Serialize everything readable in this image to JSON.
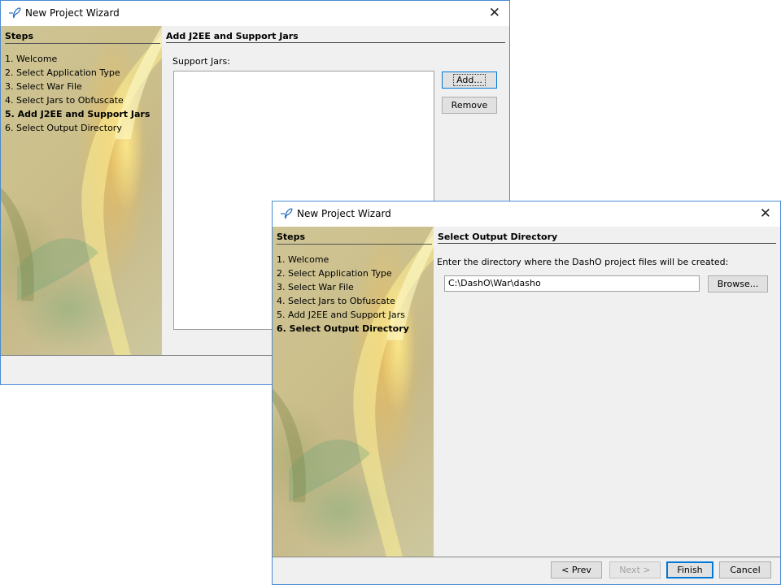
{
  "windows": [
    {
      "title": "New Project Wizard",
      "steps_heading": "Steps",
      "steps": [
        "1. Welcome",
        "2. Select Application Type",
        "3. Select War File",
        "4. Select Jars to Obfuscate",
        "5. Add J2EE and Support Jars",
        "6. Select Output Directory"
      ],
      "current_step": 5,
      "panel": {
        "heading": "Add J2EE and Support Jars",
        "support_jars_label": "Support Jars:",
        "add_button": "Add...",
        "remove_button": "Remove"
      }
    },
    {
      "title": "New Project Wizard",
      "steps_heading": "Steps",
      "steps": [
        "1. Welcome",
        "2. Select Application Type",
        "3. Select War File",
        "4. Select Jars to Obfuscate",
        "5. Add J2EE and Support Jars",
        "6. Select Output Directory"
      ],
      "current_step": 6,
      "panel": {
        "heading": "Select Output Directory",
        "instruction": "Enter the directory where the DashO project files will be created:",
        "directory_value": "C:\\DashO\\War\\dasho",
        "browse_button": "Browse..."
      },
      "footer": {
        "prev_button": "< Prev",
        "next_button": "Next >",
        "finish_button": "Finish",
        "cancel_button": "Cancel"
      }
    }
  ],
  "icons": {
    "title_logo": "dasho-logo-icon",
    "close": "close-icon"
  },
  "colors": {
    "window_border": "#4a8ad4",
    "focus_blue": "#0078d7",
    "dialog_bg": "#f0f0f0"
  }
}
